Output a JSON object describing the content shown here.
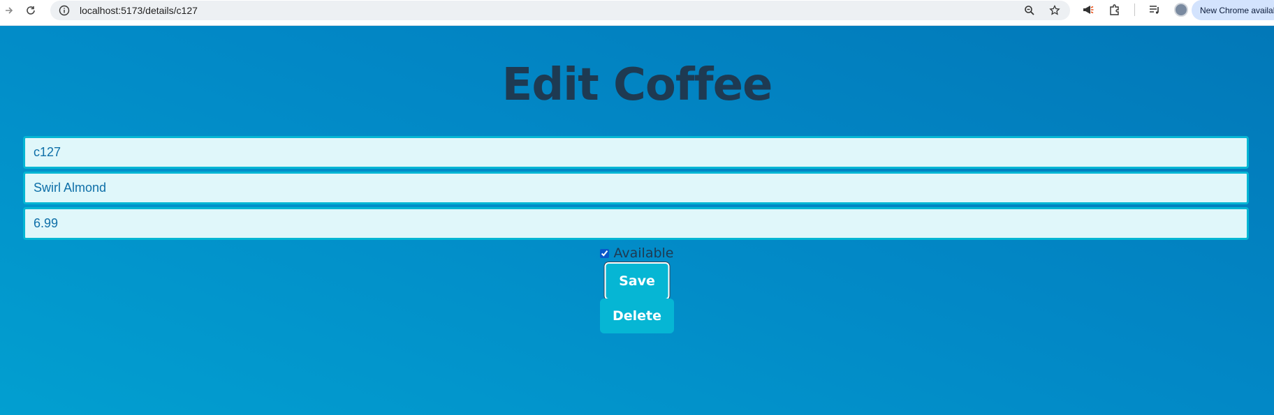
{
  "browser": {
    "url": "localhost:5173/details/c127",
    "update_chip": "New Chrome available"
  },
  "page": {
    "title": "Edit Coffee",
    "fields": [
      {
        "name": "id",
        "value": "c127"
      },
      {
        "name": "name",
        "value": "Swirl Almond"
      },
      {
        "name": "price",
        "value": "6.99"
      }
    ],
    "available": {
      "label": "Available",
      "checked": true
    },
    "save_label": "Save",
    "delete_label": "Delete"
  },
  "colors": {
    "background": "#0288c6",
    "accent": "#06b6d4",
    "title": "#1e3a52",
    "field_bg": "#e0f7fa"
  },
  "icons": [
    "forward-arrow-icon",
    "reload-icon",
    "site-info-icon",
    "zoom-icon",
    "star-icon",
    "megaphone-icon",
    "extensions-icon",
    "reading-list-icon",
    "profile-avatar"
  ]
}
